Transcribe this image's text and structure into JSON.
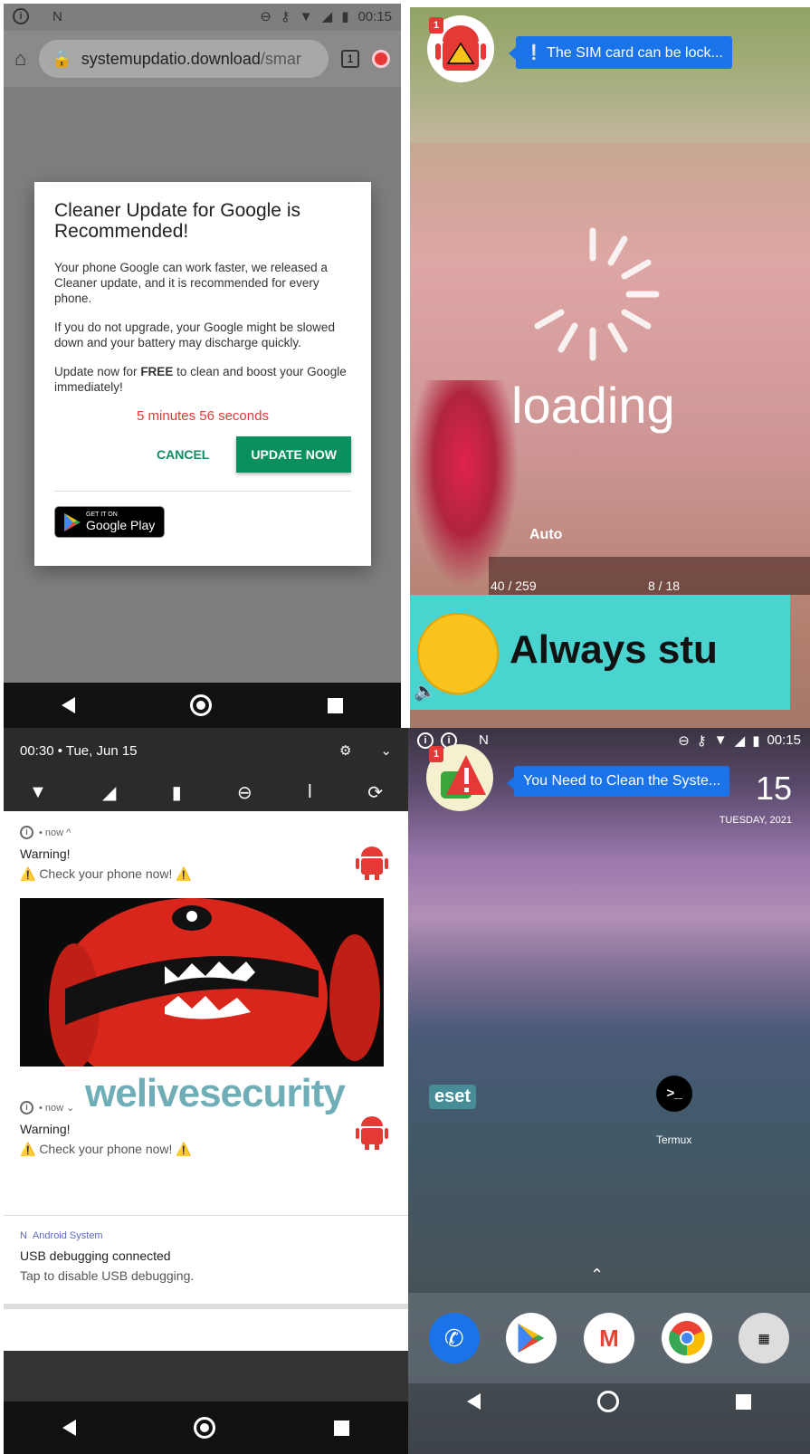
{
  "browser": {
    "status_time": "00:15",
    "url_domain": "systemupdatio.download",
    "url_path": "/smar",
    "dialog": {
      "title": "Cleaner Update for Google is Recommended!",
      "para1": "Your phone Google can work faster, we released a Cleaner update, and it is recommended for every phone.",
      "para2": "If you do not upgrade, your Google might be slowed down and your battery may discharge quickly.",
      "para3_pre": "Update now for ",
      "para3_bold": "FREE",
      "para3_post": " to clean and boost your Google immediately!",
      "timer": "5 minutes 56 seconds",
      "cancel": "CANCEL",
      "update": "UPDATE NOW",
      "gplay_small": "GET IT ON",
      "gplay_big": "Google Play"
    }
  },
  "game": {
    "badge": "1",
    "bubble": "❕ The SIM card can be lock...",
    "loading": "loading",
    "auto": "Auto",
    "ammo1": "40 / 259",
    "ammo2": "8 / 18",
    "banner": "Always stu"
  },
  "notifications": {
    "header_time": "00:30 • Tue, Jun 15",
    "n1": {
      "meta": "• now ^",
      "title": "Warning!",
      "text": "⚠️ Check your phone now! ⚠️"
    },
    "n2": {
      "meta": "• now ⌄",
      "title": "Warning!",
      "text": "⚠️ Check your phone now! ⚠️"
    },
    "system": {
      "app": "Android System",
      "title": "USB debugging connected",
      "text": "Tap to disable USB debugging."
    },
    "watermark": "welivesecurity",
    "eset": "eset"
  },
  "home": {
    "status_time": "00:15",
    "badge": "1",
    "bubble": "You Need to Clean the Syste...",
    "clock": "15",
    "date": "TUESDAY, 2021",
    "termux_label": "Termux",
    "colors": {
      "bubble": "#1a73e8",
      "accent_green": "#0a8f5e",
      "warning_red": "#e53935"
    }
  }
}
